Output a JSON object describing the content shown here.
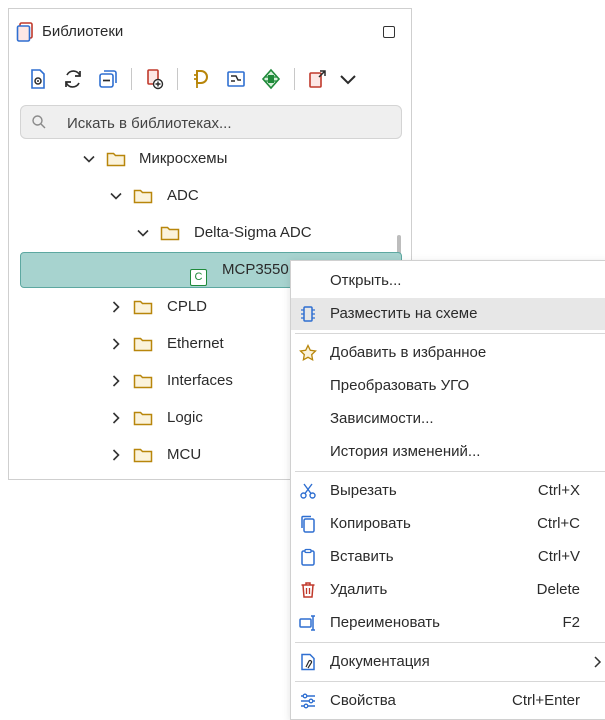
{
  "panel": {
    "title": "Библиотеки",
    "search_placeholder": "Искать в библиотеках..."
  },
  "toolbar": {
    "buttons": [
      "view-library-icon",
      "refresh-icon",
      "collapse-all-icon",
      "add-library-icon",
      "symbol-icon",
      "footprint-icon",
      "component-icon",
      "export-icon"
    ]
  },
  "tree": {
    "rows": [
      {
        "label": "Микросхемы",
        "expanded": true
      },
      {
        "label": "ADC",
        "expanded": true
      },
      {
        "label": "Delta-Sigma ADC",
        "expanded": true
      },
      {
        "label": "MCP3550",
        "type": "component",
        "icon_letter": "C"
      },
      {
        "label": "CPLD",
        "expanded": false
      },
      {
        "label": "Ethernet",
        "expanded": false
      },
      {
        "label": "Interfaces",
        "expanded": false
      },
      {
        "label": "Logic",
        "expanded": false
      },
      {
        "label": "MCU",
        "expanded": false
      }
    ]
  },
  "context_menu": {
    "items": [
      {
        "label": "Открыть...",
        "shortcut": ""
      },
      {
        "label": "Разместить на схеме",
        "shortcut": ""
      },
      {
        "label": "Добавить в избранное",
        "shortcut": ""
      },
      {
        "label": "Преобразовать УГО",
        "shortcut": ""
      },
      {
        "label": "Зависимости...",
        "shortcut": ""
      },
      {
        "label": "История изменений...",
        "shortcut": ""
      },
      {
        "label": "Вырезать",
        "shortcut": "Ctrl+X"
      },
      {
        "label": "Копировать",
        "shortcut": "Ctrl+C"
      },
      {
        "label": "Вставить",
        "shortcut": "Ctrl+V"
      },
      {
        "label": "Удалить",
        "shortcut": "Delete"
      },
      {
        "label": "Переименовать",
        "shortcut": "F2"
      },
      {
        "label": "Документация",
        "shortcut": ""
      },
      {
        "label": "Свойства",
        "shortcut": "Ctrl+Enter"
      }
    ]
  },
  "colors": {
    "selection": "#a7d3cf",
    "selection_border": "#5da8a1",
    "menu_highlight": "#e7e7e7",
    "folder": "#b8860b",
    "accent_blue": "#2f6fd1",
    "component_green": "#1f8a3a",
    "delete_red": "#c0392b"
  }
}
